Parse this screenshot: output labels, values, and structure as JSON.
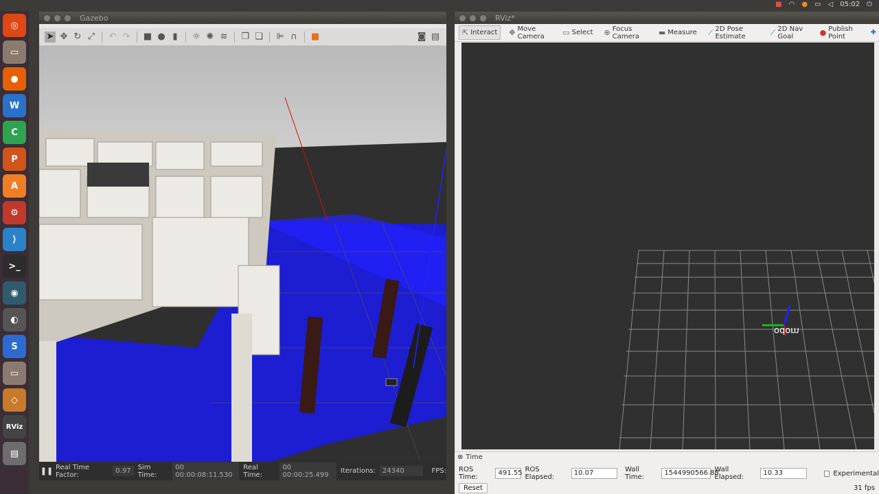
{
  "topbar": {
    "time": "05:02"
  },
  "launcher": {
    "icons": [
      {
        "name": "ubuntu-dash-icon",
        "color": "#dd4814",
        "label": "◎"
      },
      {
        "name": "files-icon",
        "color": "#8b7b6e",
        "label": "▭"
      },
      {
        "name": "firefox-icon",
        "color": "#e66000",
        "label": "●"
      },
      {
        "name": "writer-icon",
        "color": "#2a72c9",
        "label": "W"
      },
      {
        "name": "calc-icon",
        "color": "#2ea44f",
        "label": "C"
      },
      {
        "name": "impress-icon",
        "color": "#d2541b",
        "label": "P"
      },
      {
        "name": "software-center-icon",
        "color": "#f07e26",
        "label": "A"
      },
      {
        "name": "settings-icon",
        "color": "#c0392b",
        "label": "⚙"
      },
      {
        "name": "vscode-icon",
        "color": "#2b82c9",
        "label": "⟩"
      },
      {
        "name": "terminal-icon",
        "color": "#2c2c2c",
        "label": ">_"
      },
      {
        "name": "gazebo-icon",
        "color": "#2e5c6e",
        "label": "◉"
      },
      {
        "name": "camera-icon",
        "color": "#555555",
        "label": "◐"
      },
      {
        "name": "simplenote-icon",
        "color": "#2c6bd1",
        "label": "S"
      },
      {
        "name": "files2-icon",
        "color": "#8b7b6e",
        "label": "▭"
      },
      {
        "name": "box-icon",
        "color": "#c67a2a",
        "label": "◇"
      },
      {
        "name": "rviz-icon",
        "color": "#444444",
        "label": "RViz"
      },
      {
        "name": "trash-icon",
        "color": "#6d6d6d",
        "label": "▤"
      }
    ]
  },
  "gazebo": {
    "title": "Gazebo",
    "status": {
      "real_time_factor_label": "Real Time Factor:",
      "real_time_factor": "0.97",
      "sim_time_label": "Sim Time:",
      "sim_time": "00 00:00:08:11.530",
      "real_time_label": "Real Time:",
      "real_time": "00 00:00:25.499",
      "iterations_label": "Iterations:",
      "iterations": "24340",
      "fps_label": "FPS:"
    }
  },
  "rviz": {
    "title": "RViz*",
    "tools": [
      {
        "name": "interact",
        "label": "Interact",
        "icon": "⇱",
        "active": true
      },
      {
        "name": "move-camera",
        "label": "Move Camera",
        "icon": "✥",
        "active": false
      },
      {
        "name": "select",
        "label": "Select",
        "icon": "▭",
        "active": false
      },
      {
        "name": "focus-camera",
        "label": "Focus Camera",
        "icon": "⊕",
        "active": false
      },
      {
        "name": "measure",
        "label": "Measure",
        "icon": "▬",
        "active": false
      },
      {
        "name": "2d-pose-estimate",
        "label": "2D Pose Estimate",
        "icon": "⟋",
        "active": false
      },
      {
        "name": "2d-nav-goal",
        "label": "2D Nav Goal",
        "icon": "⟋",
        "active": false
      },
      {
        "name": "publish-point",
        "label": "Publish Point",
        "icon": "●",
        "active": false
      }
    ],
    "frame_label": "odom",
    "time_panel": {
      "title": "Time",
      "ros_time_label": "ROS Time:",
      "ros_time": "491.55",
      "ros_elapsed_label": "ROS Elapsed:",
      "ros_elapsed": "10.07",
      "wall_time_label": "Wall Time:",
      "wall_time": "1544990566.88",
      "wall_elapsed_label": "Wall Elapsed:",
      "wall_elapsed": "10.33",
      "experimental_label": "Experimental",
      "reset_label": "Reset",
      "fps": "31 fps"
    }
  }
}
